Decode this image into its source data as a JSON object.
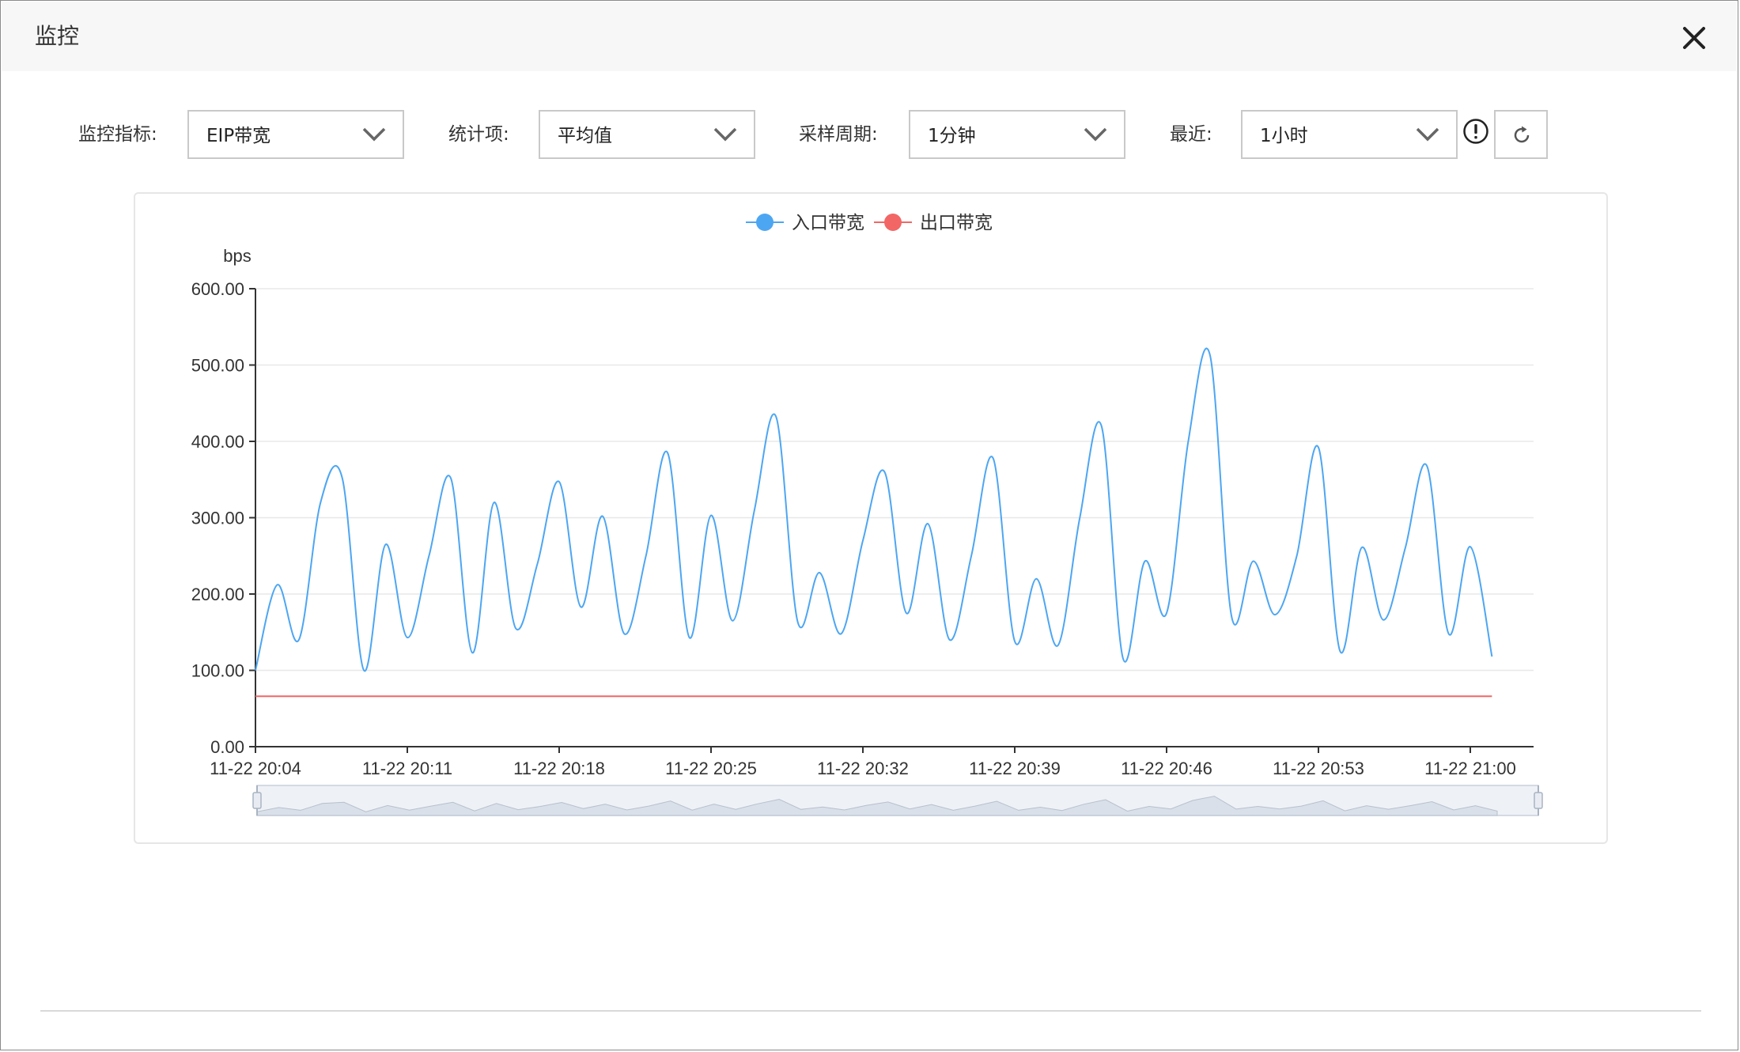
{
  "dialog": {
    "title": "监控"
  },
  "filters": {
    "metric_label": "监控指标:",
    "metric_value": "EIP带宽",
    "stat_label": "统计项:",
    "stat_value": "平均值",
    "period_label": "采样周期:",
    "period_value": "1分钟",
    "recent_label": "最近:",
    "recent_value": "1小时"
  },
  "icons": {
    "close": "close-icon",
    "chevron": "chevron-down-icon",
    "info": "info-icon",
    "refresh": "refresh-icon"
  },
  "colors": {
    "inbound": "#4da6f2",
    "outbound": "#f26666",
    "slider_fill": "#d9e0ea"
  },
  "chart_data": {
    "type": "line",
    "ylabel": "bps",
    "ylim": [
      0,
      600
    ],
    "yticks": [
      "0.00",
      "100.00",
      "200.00",
      "300.00",
      "400.00",
      "500.00",
      "600.00"
    ],
    "xticks": [
      "11-22 20:04",
      "11-22 20:11",
      "11-22 20:18",
      "11-22 20:25",
      "11-22 20:32",
      "11-22 20:39",
      "11-22 20:46",
      "11-22 20:53",
      "11-22 21:00"
    ],
    "x_start": "20:04",
    "x_end": "21:00",
    "legend_position": "top-center",
    "grid": true,
    "series": [
      {
        "name": "入口带宽",
        "values": [
          100,
          212,
          140,
          320,
          352,
          100,
          265,
          143,
          250,
          352,
          123,
          320,
          155,
          240,
          347,
          183,
          302,
          148,
          250,
          385,
          143,
          303,
          165,
          310,
          432,
          163,
          228,
          148,
          270,
          360,
          175,
          292,
          140,
          250,
          378,
          138,
          220,
          133,
          300,
          420,
          115,
          243,
          175,
          400,
          513,
          170,
          243,
          173,
          250,
          392,
          125,
          261,
          166,
          260,
          368,
          148,
          262,
          118
        ]
      },
      {
        "name": "出口带宽",
        "values": [
          66,
          66,
          66,
          66,
          66,
          66,
          66,
          66,
          66,
          66,
          66,
          66,
          66,
          66,
          66,
          66,
          66,
          66,
          66,
          66,
          66,
          66,
          66,
          66,
          66,
          66,
          66,
          66,
          66,
          66,
          66,
          66,
          66,
          66,
          66,
          66,
          66,
          66,
          66,
          66,
          66,
          66,
          66,
          66,
          66,
          66,
          66,
          66,
          66,
          66,
          66,
          66,
          66,
          66,
          66,
          66,
          66,
          66
        ]
      }
    ]
  }
}
